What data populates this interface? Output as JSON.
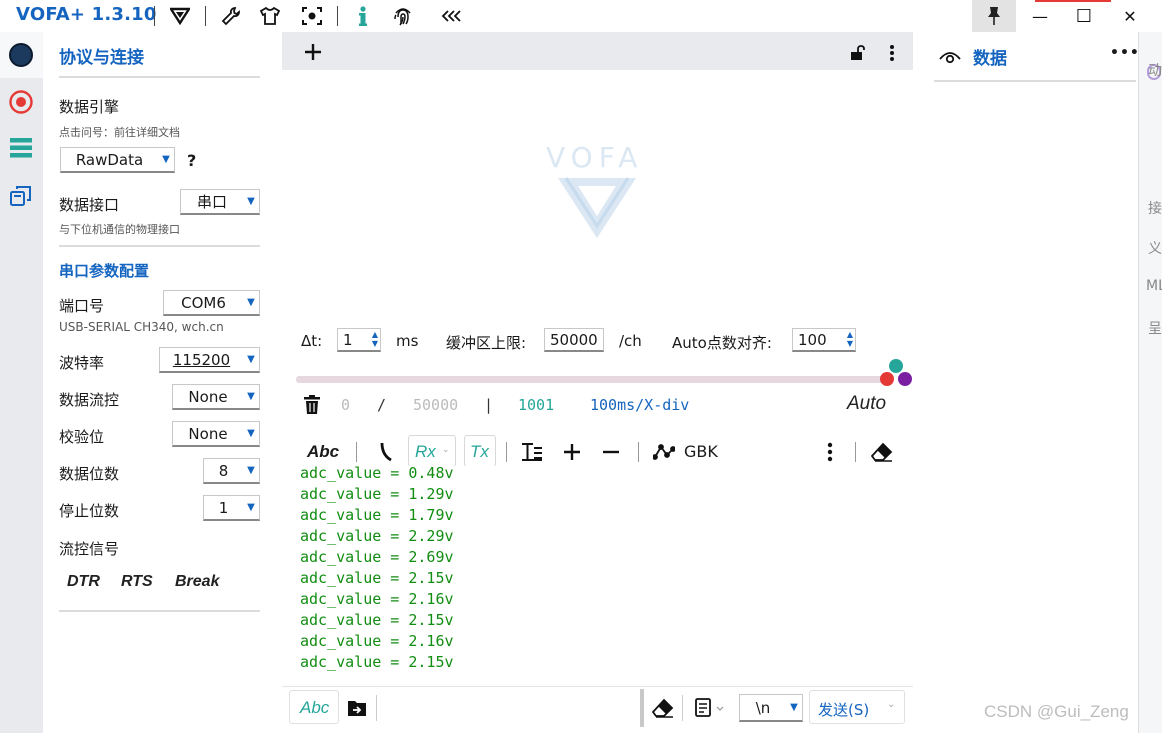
{
  "app": {
    "title": "VOFA+ 1.3.10"
  },
  "titlebar": {
    "minimize": "—",
    "maximize": "☐",
    "close": "✕"
  },
  "left_panel": {
    "section1_title": "协议与连接",
    "engine_label": "数据引擎",
    "engine_hint": "点击问号：前往详细文档",
    "engine_value": "RawData",
    "help": "?",
    "interface_label": "数据接口",
    "interface_value": "串口",
    "interface_hint": "与下位机通信的物理接口",
    "section2_title": "串口参数配置",
    "port_label": "端口号",
    "port_value": "COM6",
    "port_hint": "USB-SERIAL CH340, wch.cn",
    "baud_label": "波特率",
    "baud_value": "115200",
    "flow_label": "数据流控",
    "flow_value": "None",
    "parity_label": "校验位",
    "parity_value": "None",
    "databits_label": "数据位数",
    "databits_value": "8",
    "stopbits_label": "停止位数",
    "stopbits_value": "1",
    "signals_label": "流控信号",
    "signals": {
      "dtr": "DTR",
      "rts": "RTS",
      "brk": "Break"
    }
  },
  "plot": {
    "watermark": "VOFA"
  },
  "controls": {
    "dt_label": "Δt:",
    "dt_value": "1",
    "dt_unit": "ms",
    "buffer_label": "缓冲区上限:",
    "buffer_value": "50000",
    "buffer_unit": "/ch",
    "align_label": "Auto点数对齐:",
    "align_value": "100"
  },
  "stats": {
    "current": "0",
    "slash": "/",
    "max": "50000",
    "bar": "|",
    "count": "1001",
    "scale": "100ms/X-div",
    "mode": "Auto"
  },
  "terminal_toolbar": {
    "abc": "Abc",
    "rx": "Rx",
    "tx": "Tx",
    "encoding": "GBK"
  },
  "terminal": {
    "lines": [
      "adc_value = 0.48v",
      "adc_value = 1.29v",
      "adc_value = 1.79v",
      "adc_value = 2.29v",
      "adc_value = 2.69v",
      "adc_value = 2.15v",
      "adc_value = 2.16v",
      "adc_value = 2.15v",
      "adc_value = 2.16v",
      "adc_value = 2.15v"
    ]
  },
  "send_bar": {
    "abc": "Abc",
    "newline": "\\n",
    "send": "发送(S)"
  },
  "right_panel": {
    "title": "数据",
    "more": "•••"
  },
  "edge_chars": [
    "动",
    "接",
    "义",
    "ML",
    "呈"
  ],
  "watermark": "CSDN @Gui_Zeng",
  "colors": {
    "accent": "#1565c0",
    "term_text": "#118d11",
    "teal": "#26a69a",
    "red_dot": "#e53935",
    "purple_dot": "#7b1fa2"
  }
}
